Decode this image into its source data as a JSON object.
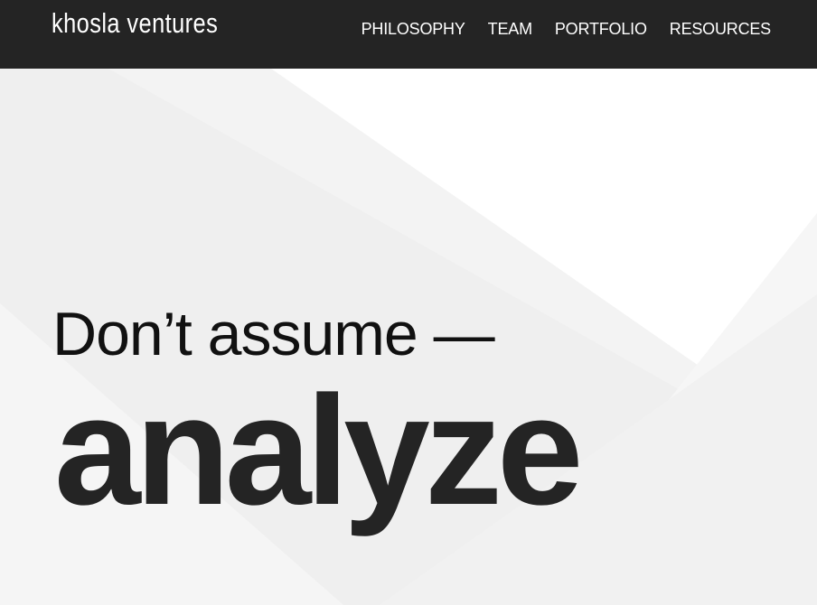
{
  "header": {
    "logo": "khosla ventures",
    "nav": [
      {
        "label": "PHILOSOPHY"
      },
      {
        "label": "TEAM"
      },
      {
        "label": "PORTFOLIO"
      },
      {
        "label": "RESOURCES"
      }
    ]
  },
  "hero": {
    "line1": "Don’t assume —",
    "line2": "analyze"
  },
  "colors": {
    "header_bg": "#242424",
    "header_text": "#ffffff",
    "hero_text": "#242424",
    "background": "#ffffff"
  }
}
